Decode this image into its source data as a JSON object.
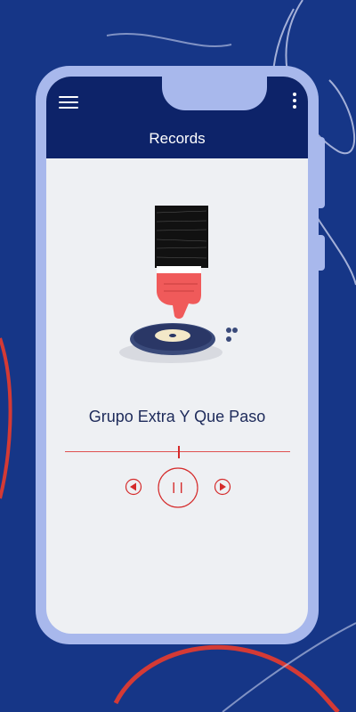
{
  "app": {
    "title": "Records"
  },
  "player": {
    "track_title": "Grupo Extra Y Que Paso",
    "progress": 0.5,
    "state": "playing"
  },
  "icons": {
    "menu": "hamburger-menu-icon",
    "more": "vertical-dots-icon",
    "previous": "previous-track-icon",
    "pause": "pause-icon",
    "next": "next-track-icon"
  },
  "colors": {
    "background": "#163687",
    "appbar": "#0d2369",
    "phone_frame": "#a8b8ec",
    "screen": "#eef0f3",
    "accent": "#d52b2b",
    "track_text": "#1d2a5a"
  }
}
